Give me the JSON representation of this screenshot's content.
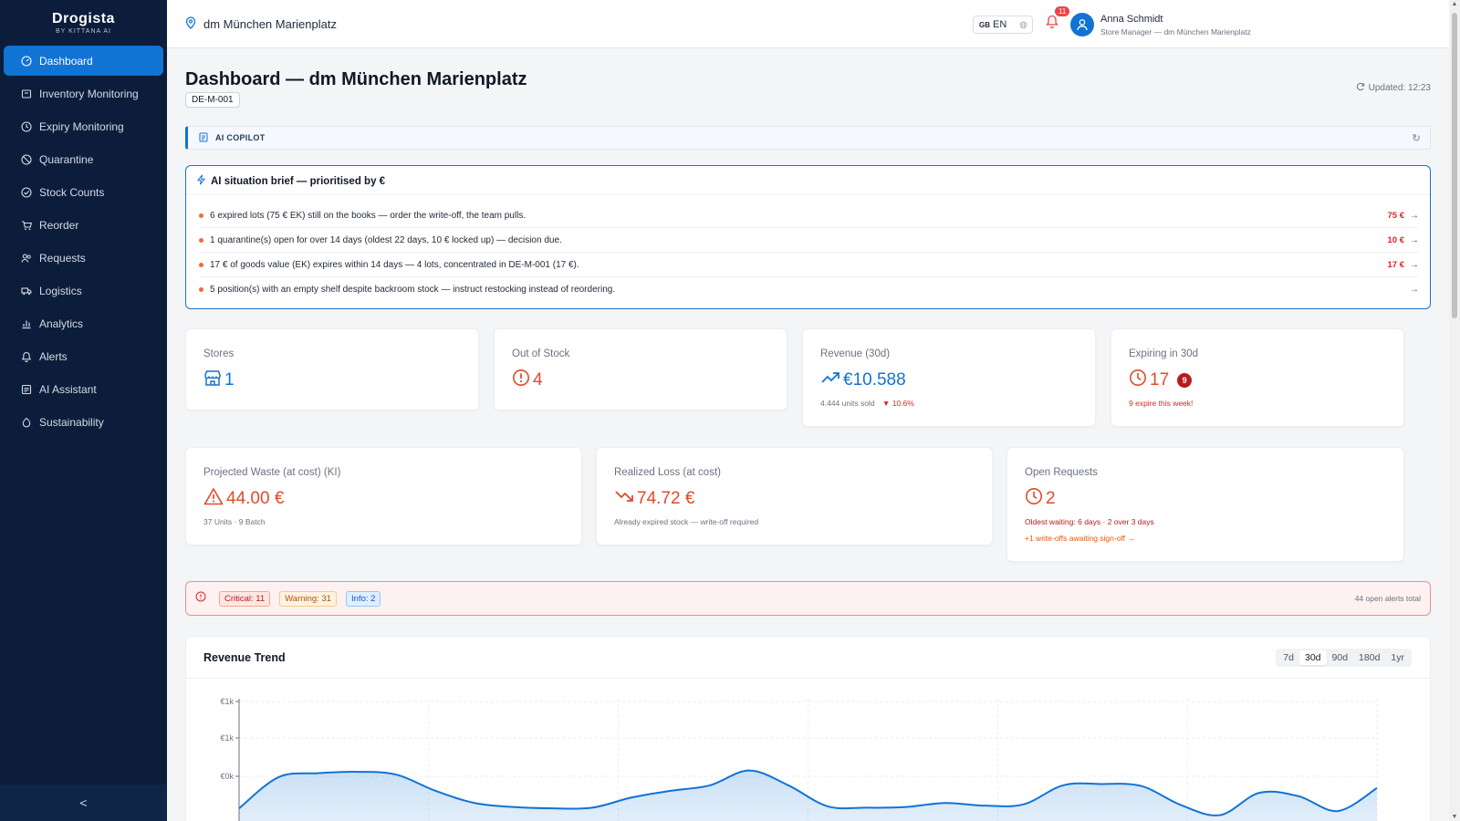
{
  "brand": {
    "name": "Drogista",
    "sub": "BY KITTANA AI"
  },
  "sidebar": {
    "items": [
      {
        "label": "Dashboard",
        "icon": "gauge-icon",
        "active": true
      },
      {
        "label": "Inventory Monitoring",
        "icon": "box-icon"
      },
      {
        "label": "Expiry Monitoring",
        "icon": "clock-icon"
      },
      {
        "label": "Quarantine",
        "icon": "ban-icon"
      },
      {
        "label": "Stock Counts",
        "icon": "check-circle-icon"
      },
      {
        "label": "Reorder",
        "icon": "cart-icon"
      },
      {
        "label": "Requests",
        "icon": "users-icon"
      },
      {
        "label": "Logistics",
        "icon": "truck-icon"
      },
      {
        "label": "Analytics",
        "icon": "bar-chart-icon"
      },
      {
        "label": "Alerts",
        "icon": "bell-icon"
      },
      {
        "label": "AI Assistant",
        "icon": "chat-icon"
      },
      {
        "label": "Sustainability",
        "icon": "leaf-icon"
      }
    ],
    "collapse": "<"
  },
  "topbar": {
    "store": "dm München Marienplatz",
    "lang_flag": "GB",
    "lang": "EN",
    "notifications": "11",
    "user_name": "Anna Schmidt",
    "user_role": "Store Manager — dm München Marienplatz"
  },
  "page": {
    "title": "Dashboard — dm München Marienplatz",
    "store_code": "DE-M-001",
    "updated": "Updated: 12:23"
  },
  "copilot": {
    "label": "AI COPILOT"
  },
  "brief": {
    "title": "AI situation brief — prioritised by €",
    "items": [
      {
        "text": "6 expired lots (75 € EK) still on the books — order the write-off, the team pulls.",
        "amount": "75 €",
        "arrow": "→"
      },
      {
        "text": "1 quarantine(s) open for over 14 days (oldest 22 days, 10 € locked up) — decision due.",
        "amount": "10 €",
        "arrow": "→"
      },
      {
        "text": "17 € of goods value (EK) expires within 14 days — 4 lots, concentrated in DE-M-001 (17 €).",
        "amount": "17 €",
        "arrow": "→"
      },
      {
        "text": "5 position(s) with an empty shelf despite backroom stock — instruct restocking instead of reordering.",
        "amount": "",
        "arrow": "→"
      }
    ]
  },
  "kpis": {
    "stores": {
      "label": "Stores",
      "value": "1"
    },
    "out_of_stock": {
      "label": "Out of Stock",
      "value": "4"
    },
    "revenue": {
      "label": "Revenue (30d)",
      "value": "€10.588",
      "sub": "4.444 units sold",
      "change": "▼ 10.6%"
    },
    "expiring": {
      "label": "Expiring in 30d",
      "value": "17",
      "badge": "9",
      "sub": "9 expire this week!"
    },
    "waste": {
      "label": "Projected Waste (at cost) (KI)",
      "value": "44.00 €",
      "sub": "37 Units · 9 Batch"
    },
    "loss": {
      "label": "Realized Loss (at cost)",
      "value": "74.72 €",
      "sub": "Already expired stock — write-off required"
    },
    "requests": {
      "label": "Open Requests",
      "value": "2",
      "sub": "Oldest waiting: 6 days · 2 over 3 days",
      "link": "+1 write-offs awaiting sign-off →"
    }
  },
  "alerts": {
    "critical": "Critical: 11",
    "warning": "Warning: 31",
    "info": "Info: 2",
    "total": "44 open alerts total"
  },
  "trend": {
    "title": "Revenue Trend",
    "ranges": [
      "7d",
      "30d",
      "90d",
      "180d",
      "1yr"
    ],
    "active_range": "30d"
  },
  "colors": {
    "accent": "#1173d4",
    "sidebar": "#0b1d3a",
    "danger": "#dc2626"
  },
  "chart_data": {
    "type": "area",
    "y_ticks": [
      "€1k",
      "€1k",
      "€0k"
    ],
    "ylim": [
      0,
      1200
    ],
    "values": [
      390,
      620,
      650,
      660,
      640,
      520,
      430,
      400,
      390,
      395,
      470,
      520,
      560,
      670,
      560,
      405,
      395,
      400,
      430,
      410,
      420,
      560,
      570,
      555,
      415,
      340,
      505,
      480,
      370,
      540
    ]
  }
}
